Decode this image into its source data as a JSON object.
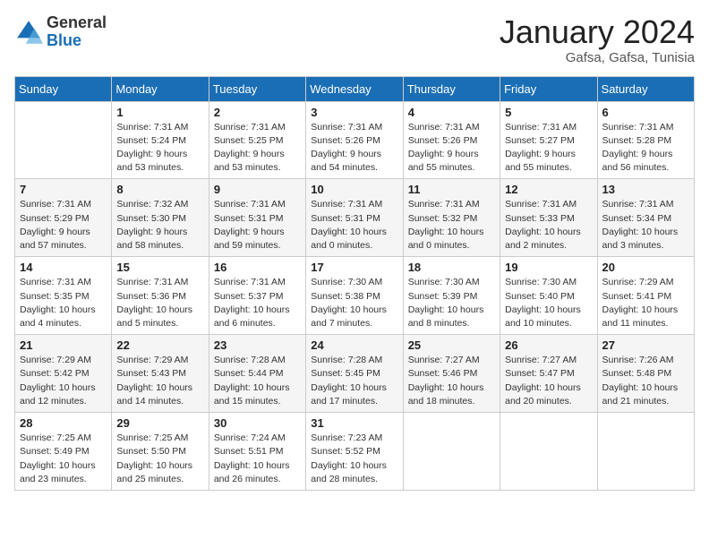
{
  "logo": {
    "general": "General",
    "blue": "Blue"
  },
  "title": "January 2024",
  "location": "Gafsa, Gafsa, Tunisia",
  "weekdays": [
    "Sunday",
    "Monday",
    "Tuesday",
    "Wednesday",
    "Thursday",
    "Friday",
    "Saturday"
  ],
  "weeks": [
    [
      {
        "day": "",
        "sunrise": "",
        "sunset": "",
        "daylight": ""
      },
      {
        "day": "1",
        "sunrise": "Sunrise: 7:31 AM",
        "sunset": "Sunset: 5:24 PM",
        "daylight": "Daylight: 9 hours and 53 minutes."
      },
      {
        "day": "2",
        "sunrise": "Sunrise: 7:31 AM",
        "sunset": "Sunset: 5:25 PM",
        "daylight": "Daylight: 9 hours and 53 minutes."
      },
      {
        "day": "3",
        "sunrise": "Sunrise: 7:31 AM",
        "sunset": "Sunset: 5:26 PM",
        "daylight": "Daylight: 9 hours and 54 minutes."
      },
      {
        "day": "4",
        "sunrise": "Sunrise: 7:31 AM",
        "sunset": "Sunset: 5:26 PM",
        "daylight": "Daylight: 9 hours and 55 minutes."
      },
      {
        "day": "5",
        "sunrise": "Sunrise: 7:31 AM",
        "sunset": "Sunset: 5:27 PM",
        "daylight": "Daylight: 9 hours and 55 minutes."
      },
      {
        "day": "6",
        "sunrise": "Sunrise: 7:31 AM",
        "sunset": "Sunset: 5:28 PM",
        "daylight": "Daylight: 9 hours and 56 minutes."
      }
    ],
    [
      {
        "day": "7",
        "sunrise": "Sunrise: 7:31 AM",
        "sunset": "Sunset: 5:29 PM",
        "daylight": "Daylight: 9 hours and 57 minutes."
      },
      {
        "day": "8",
        "sunrise": "Sunrise: 7:32 AM",
        "sunset": "Sunset: 5:30 PM",
        "daylight": "Daylight: 9 hours and 58 minutes."
      },
      {
        "day": "9",
        "sunrise": "Sunrise: 7:31 AM",
        "sunset": "Sunset: 5:31 PM",
        "daylight": "Daylight: 9 hours and 59 minutes."
      },
      {
        "day": "10",
        "sunrise": "Sunrise: 7:31 AM",
        "sunset": "Sunset: 5:31 PM",
        "daylight": "Daylight: 10 hours and 0 minutes."
      },
      {
        "day": "11",
        "sunrise": "Sunrise: 7:31 AM",
        "sunset": "Sunset: 5:32 PM",
        "daylight": "Daylight: 10 hours and 0 minutes."
      },
      {
        "day": "12",
        "sunrise": "Sunrise: 7:31 AM",
        "sunset": "Sunset: 5:33 PM",
        "daylight": "Daylight: 10 hours and 2 minutes."
      },
      {
        "day": "13",
        "sunrise": "Sunrise: 7:31 AM",
        "sunset": "Sunset: 5:34 PM",
        "daylight": "Daylight: 10 hours and 3 minutes."
      }
    ],
    [
      {
        "day": "14",
        "sunrise": "Sunrise: 7:31 AM",
        "sunset": "Sunset: 5:35 PM",
        "daylight": "Daylight: 10 hours and 4 minutes."
      },
      {
        "day": "15",
        "sunrise": "Sunrise: 7:31 AM",
        "sunset": "Sunset: 5:36 PM",
        "daylight": "Daylight: 10 hours and 5 minutes."
      },
      {
        "day": "16",
        "sunrise": "Sunrise: 7:31 AM",
        "sunset": "Sunset: 5:37 PM",
        "daylight": "Daylight: 10 hours and 6 minutes."
      },
      {
        "day": "17",
        "sunrise": "Sunrise: 7:30 AM",
        "sunset": "Sunset: 5:38 PM",
        "daylight": "Daylight: 10 hours and 7 minutes."
      },
      {
        "day": "18",
        "sunrise": "Sunrise: 7:30 AM",
        "sunset": "Sunset: 5:39 PM",
        "daylight": "Daylight: 10 hours and 8 minutes."
      },
      {
        "day": "19",
        "sunrise": "Sunrise: 7:30 AM",
        "sunset": "Sunset: 5:40 PM",
        "daylight": "Daylight: 10 hours and 10 minutes."
      },
      {
        "day": "20",
        "sunrise": "Sunrise: 7:29 AM",
        "sunset": "Sunset: 5:41 PM",
        "daylight": "Daylight: 10 hours and 11 minutes."
      }
    ],
    [
      {
        "day": "21",
        "sunrise": "Sunrise: 7:29 AM",
        "sunset": "Sunset: 5:42 PM",
        "daylight": "Daylight: 10 hours and 12 minutes."
      },
      {
        "day": "22",
        "sunrise": "Sunrise: 7:29 AM",
        "sunset": "Sunset: 5:43 PM",
        "daylight": "Daylight: 10 hours and 14 minutes."
      },
      {
        "day": "23",
        "sunrise": "Sunrise: 7:28 AM",
        "sunset": "Sunset: 5:44 PM",
        "daylight": "Daylight: 10 hours and 15 minutes."
      },
      {
        "day": "24",
        "sunrise": "Sunrise: 7:28 AM",
        "sunset": "Sunset: 5:45 PM",
        "daylight": "Daylight: 10 hours and 17 minutes."
      },
      {
        "day": "25",
        "sunrise": "Sunrise: 7:27 AM",
        "sunset": "Sunset: 5:46 PM",
        "daylight": "Daylight: 10 hours and 18 minutes."
      },
      {
        "day": "26",
        "sunrise": "Sunrise: 7:27 AM",
        "sunset": "Sunset: 5:47 PM",
        "daylight": "Daylight: 10 hours and 20 minutes."
      },
      {
        "day": "27",
        "sunrise": "Sunrise: 7:26 AM",
        "sunset": "Sunset: 5:48 PM",
        "daylight": "Daylight: 10 hours and 21 minutes."
      }
    ],
    [
      {
        "day": "28",
        "sunrise": "Sunrise: 7:25 AM",
        "sunset": "Sunset: 5:49 PM",
        "daylight": "Daylight: 10 hours and 23 minutes."
      },
      {
        "day": "29",
        "sunrise": "Sunrise: 7:25 AM",
        "sunset": "Sunset: 5:50 PM",
        "daylight": "Daylight: 10 hours and 25 minutes."
      },
      {
        "day": "30",
        "sunrise": "Sunrise: 7:24 AM",
        "sunset": "Sunset: 5:51 PM",
        "daylight": "Daylight: 10 hours and 26 minutes."
      },
      {
        "day": "31",
        "sunrise": "Sunrise: 7:23 AM",
        "sunset": "Sunset: 5:52 PM",
        "daylight": "Daylight: 10 hours and 28 minutes."
      },
      {
        "day": "",
        "sunrise": "",
        "sunset": "",
        "daylight": ""
      },
      {
        "day": "",
        "sunrise": "",
        "sunset": "",
        "daylight": ""
      },
      {
        "day": "",
        "sunrise": "",
        "sunset": "",
        "daylight": ""
      }
    ]
  ]
}
